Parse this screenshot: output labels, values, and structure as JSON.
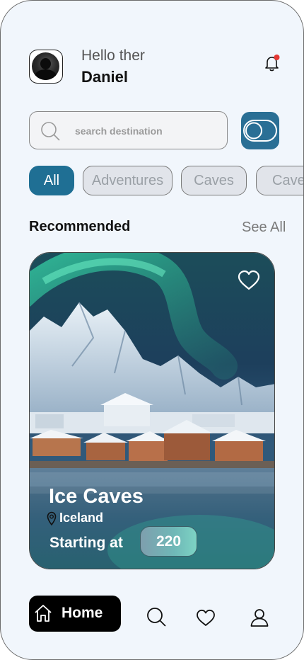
{
  "header": {
    "greeting": "Hello ther",
    "user_name": "Daniel",
    "avatar_icon": "user-avatar-photo",
    "notification_icon": "bell-icon",
    "notification_dot_color": "#e53935"
  },
  "search": {
    "placeholder": "search destination",
    "icon": "search-icon",
    "filter_icon": "toggle-icon",
    "filter_color": "#2a6f95"
  },
  "categories": [
    {
      "label": "All",
      "active": true
    },
    {
      "label": "Adventures",
      "active": false
    },
    {
      "label": "Caves",
      "active": false
    },
    {
      "label": "Cave",
      "active": false
    }
  ],
  "section": {
    "title": "Recommended",
    "see_all": "See All"
  },
  "card": {
    "name": "Ice Caves",
    "location": "Iceland",
    "starting_label": "Starting at",
    "price": "220",
    "favorite_icon": "heart-outline-icon",
    "location_icon": "map-pin-icon"
  },
  "bottom_nav": {
    "home_label": "Home",
    "home_icon": "home-icon",
    "items": [
      "search-icon",
      "heart-icon",
      "profile-icon"
    ],
    "active_color": "#000000"
  }
}
